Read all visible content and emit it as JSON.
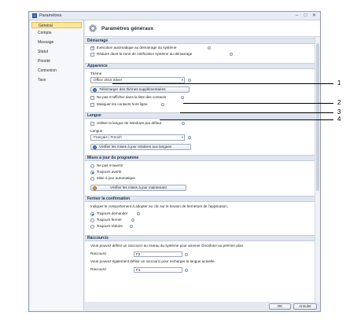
{
  "window": {
    "title": "Paramètres"
  },
  "titlebar_buttons": [
    "minimize",
    "maximize",
    "close"
  ],
  "sidebar": {
    "items": [
      {
        "label": "Général",
        "active": true
      },
      {
        "label": "Compte"
      },
      {
        "label": "Message"
      },
      {
        "label": "Statut"
      },
      {
        "label": "Priorité"
      },
      {
        "label": "Connexion"
      },
      {
        "label": "Tavs"
      }
    ]
  },
  "header": {
    "title": "Paramètres généraux",
    "icon": "gear-icon"
  },
  "demarrage": {
    "title": "Démarrage",
    "autostart": {
      "label": "Exécution automatique au démarrage du système",
      "checked": true
    },
    "tray": {
      "label": "Réduire dans la zone de notification système au démarrage",
      "checked": false
    }
  },
  "apparence": {
    "title": "Apparence",
    "theme_label": "Thème",
    "theme_value": "Office 2010 Silver",
    "download_btn": "Télécharger des thèmes supplémentaires",
    "contacts_list": {
      "label": "Ne pas m'afficher dans la liste des contacts",
      "checked": false
    },
    "offline": {
      "label": "Masquer les contacts hors ligne",
      "checked": false
    }
  },
  "langue": {
    "title": "Langue",
    "windows_lang": {
      "label": "Utiliser la langue de Windows par défaut",
      "checked": false
    },
    "lang_label": "Langue",
    "lang_value": "Français / French",
    "verify_btn": "Vérifier les mises à jour relatives aux langues"
  },
  "mises_a_jour": {
    "title": "Mises à jour du programme",
    "options": [
      {
        "label": "Ne pas m'avertir",
        "checked": false
      },
      {
        "label": "Toujours avertir",
        "checked": true
      },
      {
        "label": "Mise à jour automatique",
        "checked": false
      }
    ],
    "check_btn": "Vérifier les mises à jour maintenant"
  },
  "fermer": {
    "title": "Fermer la confirmation",
    "desc": "Indiquer le comportement à adopter au clic sur le bouton de fermeture de l'application.",
    "options": [
      {
        "label": "Toujours demander",
        "checked": true
      },
      {
        "label": "Toujours fermer",
        "checked": false
      },
      {
        "label": "Toujours réduire",
        "checked": false
      }
    ]
  },
  "raccourcis": {
    "title": "Raccourcis",
    "desc1": "Vous pouvez définir un raccourci au niveau du système pour amener Omnifone au premier plan.",
    "label1": "Raccourci",
    "value1": "F2",
    "desc2": "Vous pouvez également définir un raccourci pour recharger la langue actuelle.",
    "label2": "Raccourci",
    "value2": "F1"
  },
  "footer": {
    "ok": "OK",
    "cancel": "Annuler"
  },
  "callouts": [
    "1",
    "2",
    "3",
    "4"
  ]
}
